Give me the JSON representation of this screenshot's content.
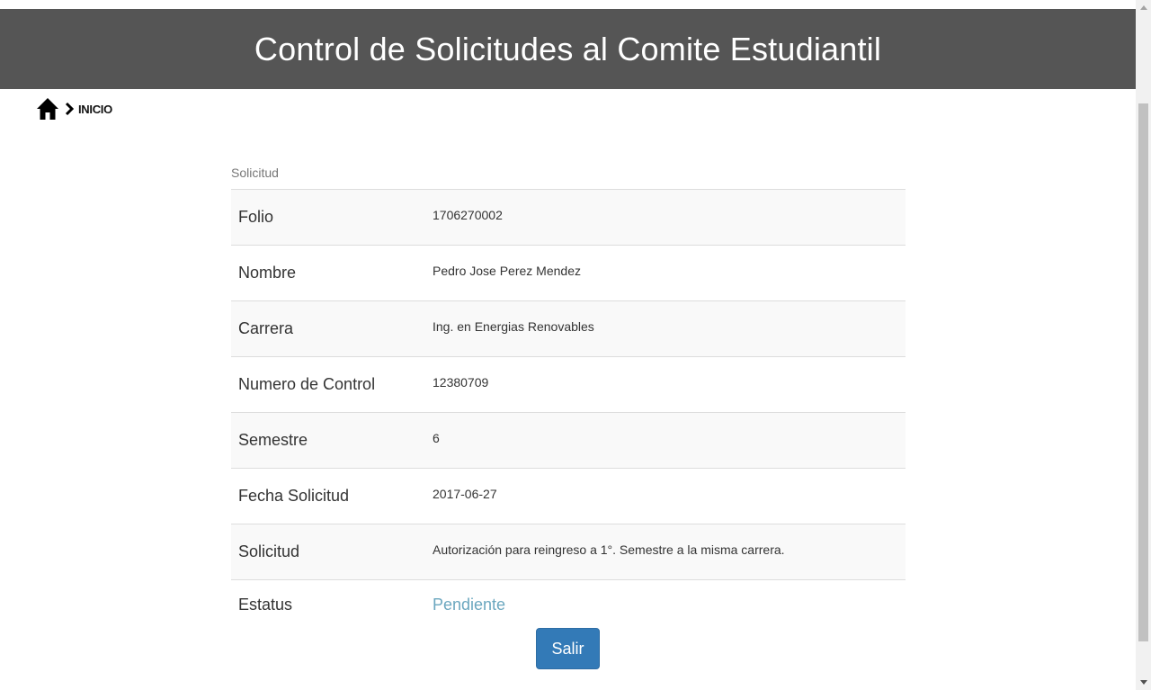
{
  "header": {
    "title": "Control de Solicitudes al Comite Estudiantil"
  },
  "breadcrumb": {
    "home_icon": "home-icon",
    "chevron_icon": "chevron-right-icon",
    "label": "INICIO"
  },
  "panel": {
    "caption": "Solicitud",
    "rows": [
      {
        "key": "Folio",
        "value": "1706270002"
      },
      {
        "key": "Nombre",
        "value": "Pedro Jose Perez Mendez"
      },
      {
        "key": "Carrera",
        "value": "Ing. en Energias Renovables"
      },
      {
        "key": "Numero de Control",
        "value": "12380709"
      },
      {
        "key": "Semestre",
        "value": "6"
      },
      {
        "key": "Fecha Solicitud",
        "value": "2017-06-27"
      },
      {
        "key": "Solicitud",
        "value": "Autorización para reingreso a 1°. Semestre a la misma carrera."
      },
      {
        "key": "Estatus",
        "value": "Pendiente"
      }
    ]
  },
  "actions": {
    "exit_label": "Salir"
  },
  "colors": {
    "header_bg": "#555555",
    "button_bg": "#337ab7",
    "status_pending": "#6ba7bf"
  }
}
